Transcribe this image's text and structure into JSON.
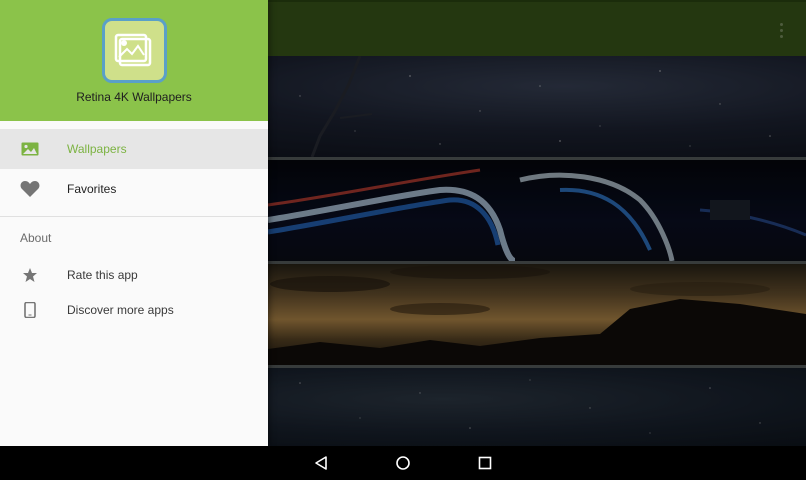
{
  "app": {
    "title": "Retina 4K Wallpapers"
  },
  "drawer": {
    "items": [
      {
        "label": "Wallpapers",
        "icon": "image-icon",
        "selected": true
      },
      {
        "label": "Favorites",
        "icon": "heart-icon",
        "selected": false
      }
    ],
    "section_title": "About",
    "about_items": [
      {
        "label": "Rate this app",
        "icon": "star-icon"
      },
      {
        "label": "Discover more apps",
        "icon": "phone-icon"
      }
    ]
  },
  "toolbar": {
    "overflow_icon": "more-vert-icon"
  },
  "wallpapers": [
    {
      "name": "starry-sky-tile"
    },
    {
      "name": "light-trails-tile"
    },
    {
      "name": "sunset-mountains-tile"
    },
    {
      "name": "milky-way-tile"
    }
  ],
  "system_nav": {
    "back_icon": "back-triangle-icon",
    "home_icon": "home-circle-icon",
    "recents_icon": "recents-square-icon"
  },
  "colors": {
    "header": "#8bc34a",
    "accent_text": "#7cb342",
    "appbar": "#3b5a1a",
    "selected_row": "#e6e6e6"
  }
}
